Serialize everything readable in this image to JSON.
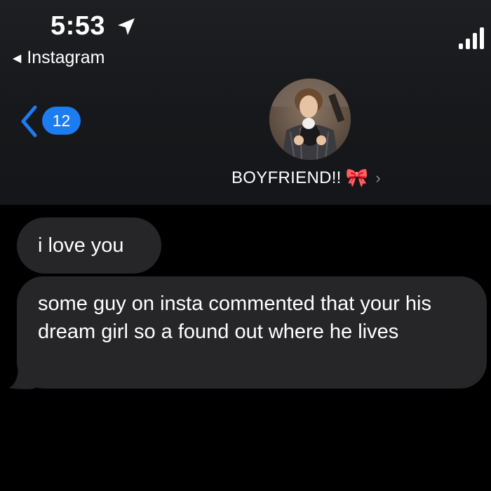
{
  "status_bar": {
    "time": "5:53",
    "location_icon": "location-arrow-icon",
    "signal_icon": "signal-bars-icon",
    "back_to_app_label": "Instagram"
  },
  "header": {
    "unread_count": "12",
    "contact_name": "BOYFRIEND!!",
    "contact_emoji": "🎀",
    "chevron": "›",
    "badge_color": "#1c7cf2"
  },
  "messages": [
    {
      "text": "i love you"
    },
    {
      "text": "some guy on insta commented that your his dream girl so a found out where he lives"
    }
  ]
}
